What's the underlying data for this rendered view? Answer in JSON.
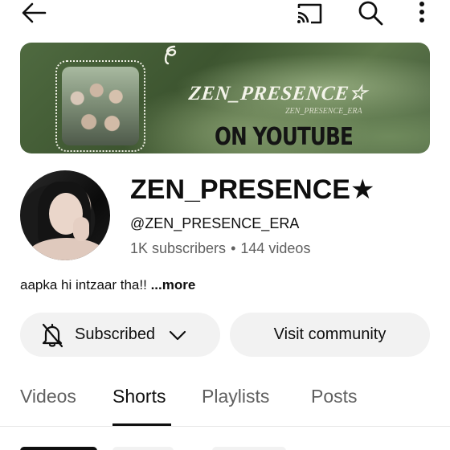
{
  "channel": {
    "name": "ZEN_PRESENCE★",
    "handle": "@ZEN_PRESENCE_ERA",
    "subscribers": "1K subscribers",
    "separator": "•",
    "videos": "144 videos",
    "description": "aapka hi intzaar tha!!",
    "more_label": "...more"
  },
  "banner": {
    "title": "ZEN_PRESENCE☆",
    "subtitle": "ZEN_PRESENCE_ERA",
    "cta": "ON YOUTUBE"
  },
  "actions": {
    "subscribed_label": "Subscribed",
    "community_label": "Visit community"
  },
  "tabs": [
    {
      "label": "Videos",
      "active": false
    },
    {
      "label": "Shorts",
      "active": true
    },
    {
      "label": "Playlists",
      "active": false
    },
    {
      "label": "Posts",
      "active": false
    }
  ],
  "icons": {
    "back": "arrow-left-icon",
    "cast": "cast-icon",
    "search": "search-icon",
    "more": "more-vertical-icon",
    "bell": "bell-off-icon",
    "chevron": "chevron-down-icon"
  },
  "colors": {
    "text_primary": "#0f0f0f",
    "text_secondary": "#606060",
    "button_bg": "#f2f2f2"
  }
}
